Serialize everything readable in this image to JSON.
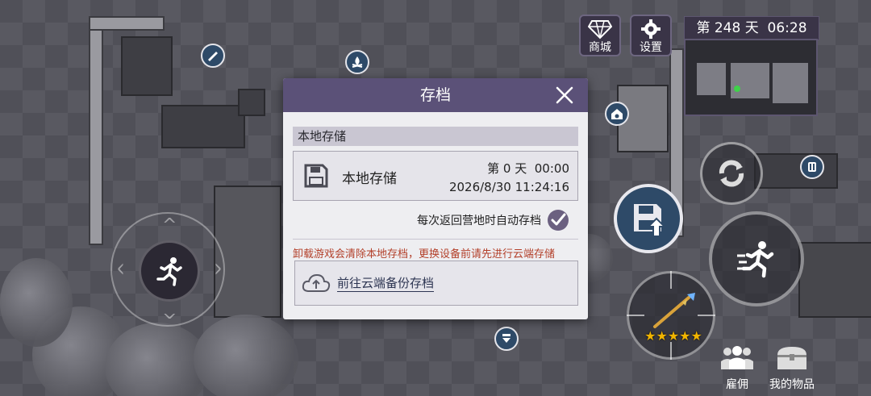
{
  "hud": {
    "shop_label": "商城",
    "settings_label": "设置",
    "day_label": "第 248 天",
    "clock": "06:28"
  },
  "dialog": {
    "title": "存档",
    "section_title": "本地存储",
    "slot": {
      "name": "本地存储",
      "day": "第 0 天",
      "time": "00:00",
      "date": "2026/8/30 11:24:16"
    },
    "autosave_label": "每次返回营地时自动存档",
    "autosave_checked": true,
    "warning": "卸载游戏会清除本地存档，更换设备前请先进行云端存储",
    "cloud_link": "前往云端备份存档"
  },
  "weapon": {
    "stars": 5
  },
  "bottom": {
    "hire_label": "雇佣",
    "items_label": "我的物品"
  },
  "colors": {
    "header_purple": "#5b5178",
    "warning_red": "#b3402a",
    "link_navy": "#2d3552",
    "save_button_blue": "#2e4a68",
    "star_gold": "#f0b400"
  },
  "icons": {
    "shop": "diamond-icon",
    "settings": "gear-icon",
    "close": "close-icon",
    "slot": "floppy-disk-icon",
    "autosave": "checkmark-icon",
    "cloud": "cloud-upload-icon",
    "joystick": "running-man-icon",
    "sprint": "sprint-icon",
    "reload": "reload-icon",
    "save_button": "save-upload-icon"
  }
}
